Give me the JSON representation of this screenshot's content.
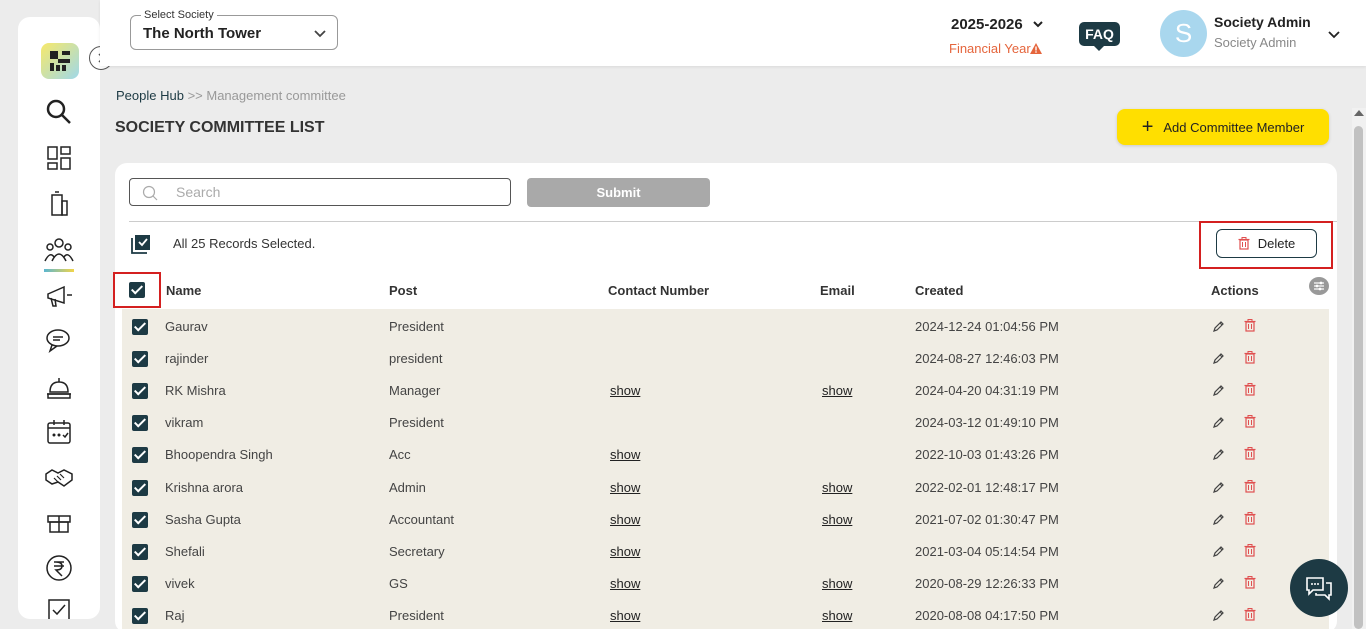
{
  "header": {
    "society_select_label": "Select Society",
    "society_value": "The North Tower",
    "financial_year": "2025-2026",
    "financial_year_label": "Financial Year",
    "faq_label": "FAQ",
    "avatar_initial": "S",
    "user_name": "Society Admin",
    "user_role": "Society Admin"
  },
  "breadcrumb": {
    "root": "People Hub",
    "separator": " >> ",
    "current": "Management committee"
  },
  "page": {
    "title": "SOCIETY COMMITTEE LIST",
    "add_button_label": "Add Committee Member"
  },
  "toolbar": {
    "search_placeholder": "Search",
    "submit_label": "Submit",
    "selection_text": "All 25 Records Selected.",
    "delete_label": "Delete"
  },
  "table": {
    "columns": [
      "Name",
      "Post",
      "Contact Number",
      "Email",
      "Created",
      "Actions"
    ],
    "rows": [
      {
        "name": "Gaurav",
        "post": "President",
        "contact": "",
        "email": "",
        "created": "2024-12-24 01:04:56 PM"
      },
      {
        "name": "rajinder",
        "post": "president",
        "contact": "",
        "email": "",
        "created": "2024-08-27 12:46:03 PM"
      },
      {
        "name": "RK Mishra",
        "post": "Manager",
        "contact": "show",
        "email": "show",
        "created": "2024-04-20 04:31:19 PM"
      },
      {
        "name": "vikram",
        "post": "President",
        "contact": "",
        "email": "",
        "created": "2024-03-12 01:49:10 PM"
      },
      {
        "name": "Bhoopendra Singh",
        "post": "Acc",
        "contact": "show",
        "email": "",
        "created": "2022-10-03 01:43:26 PM"
      },
      {
        "name": "Krishna arora",
        "post": "Admin",
        "contact": "show",
        "email": "show",
        "created": "2022-02-01 12:48:17 PM"
      },
      {
        "name": "Sasha Gupta",
        "post": "Accountant",
        "contact": "show",
        "email": "show",
        "created": "2021-07-02 01:30:47 PM"
      },
      {
        "name": "Shefali",
        "post": "Secretary",
        "contact": "show",
        "email": "",
        "created": "2021-03-04 05:14:54 PM"
      },
      {
        "name": "vivek",
        "post": "GS",
        "contact": "show",
        "email": "show",
        "created": "2020-08-29 12:26:33 PM"
      },
      {
        "name": "Raj",
        "post": "President",
        "contact": "show",
        "email": "show",
        "created": "2020-08-08 04:17:50 PM"
      }
    ]
  },
  "sidebar": {
    "items": [
      {
        "icon": "search-icon"
      },
      {
        "icon": "dashboard-icon"
      },
      {
        "icon": "building-icon"
      },
      {
        "icon": "people-icon",
        "active": true
      },
      {
        "icon": "megaphone-icon"
      },
      {
        "icon": "chat-bubbles-icon"
      },
      {
        "icon": "reception-bell-icon"
      },
      {
        "icon": "calendar-icon"
      },
      {
        "icon": "handshake-icon"
      },
      {
        "icon": "gift-box-icon"
      },
      {
        "icon": "rupee-icon"
      }
    ]
  },
  "colors": {
    "primary_dark": "#1d3a44",
    "accent_yellow": "#ffdf00",
    "warning_orange": "#e5653c",
    "delete_red": "#d42020",
    "row_bg": "#f0ede4"
  }
}
